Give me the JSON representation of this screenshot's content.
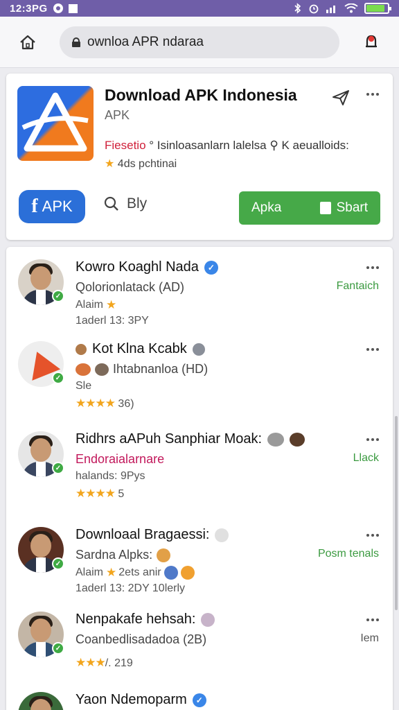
{
  "status_bar": {
    "time": "12:3PG",
    "icons": [
      "circle-icon",
      "square-icon"
    ],
    "right_icons": [
      "bluetooth-icon",
      "alarm-icon",
      "signal-icon",
      "wifi-icon",
      "battery-icon"
    ]
  },
  "browser": {
    "url": "ownloa APR ndaraa"
  },
  "app": {
    "title": "Download APK Indonesia",
    "subtitle": "APK",
    "desc_highlight": "Fiesetio",
    "desc_text": "° Isinloasanlarn lalelsa ⚲ K aeualloids:",
    "rating_text": "4ds pchtinai",
    "fb_label": "APK",
    "buy_label": "Bly",
    "get_label": "Apka",
    "start_label": "Sbart",
    "colors": {
      "accent_green": "#46a948",
      "brand_blue": "#2b6fd8",
      "status_purple": "#6f5ea8"
    }
  },
  "list": [
    {
      "name": "Kowro Koaghl Nada",
      "line2": "Qolorionlatack (AD)",
      "line3": "Alaim",
      "line3_star": "★",
      "line4": "1aderl 13: 3PY",
      "action": "Fantaich",
      "verified_blue": true
    },
    {
      "name": "Kot Klna Kcabk",
      "line2": "Ihtabnanloa (HD)",
      "line3": "Sle",
      "stars": "★★★★",
      "line4": " 36)"
    },
    {
      "name": "Ridhrs aAPuh Sanphiar Moak:",
      "line2": "Endoraialarnare",
      "line3": "halands: 9Pys",
      "stars": "★★★★",
      "line4": " 5",
      "action": "Llack"
    },
    {
      "name": "Downloaal Bragaessi:",
      "line2": "Sardna Alpks:",
      "line3": "Alaim",
      "line3_star": "★",
      "line3_b": "2ets anir",
      "line4": "1aderl 13: 2DY 10lerly",
      "action": "Posm tenals"
    },
    {
      "name": "Nenpakafe hehsah:",
      "line2": "Coanbedlisadadoa (2B)",
      "stars": "★★★",
      "line4": "/. 219",
      "action": "Iem"
    },
    {
      "name": "Yaon Ndemoparm",
      "verified_blue": true
    }
  ]
}
